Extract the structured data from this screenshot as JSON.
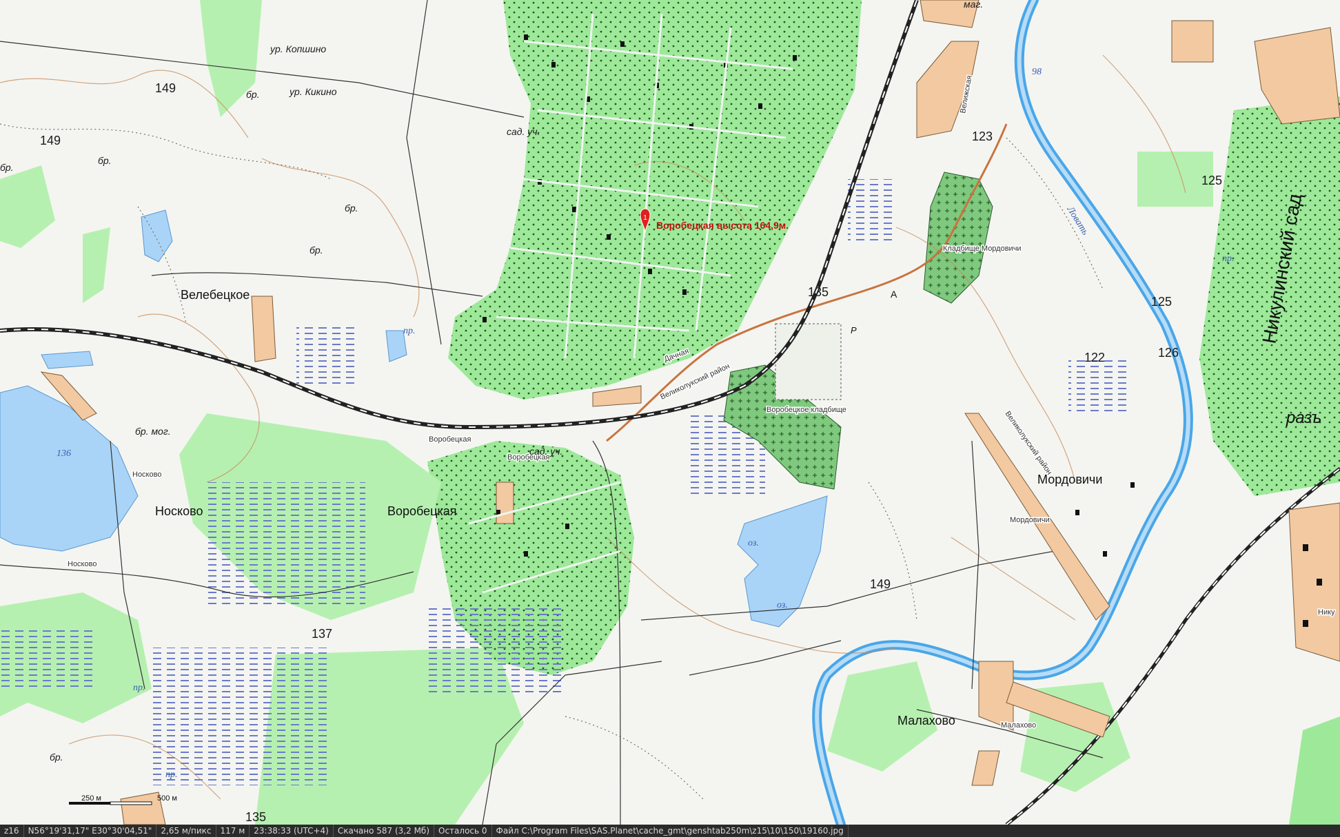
{
  "map": {
    "poi_marker": {
      "number": "1",
      "label": "Воробецкая высота 164,9м."
    },
    "settlements": [
      "Велебецкое",
      "Носково",
      "Воробецкая",
      "Мордовичи",
      "Малахово"
    ],
    "small_settlement_labels": [
      "Носково",
      "Носково",
      "Воробецкая",
      "Воробецкая",
      "Мордовичи",
      "Малахово"
    ],
    "tracts": [
      "ур. Копшино",
      "ур. Кикино"
    ],
    "garden_labels": [
      "сад. уч.",
      "сад. уч."
    ],
    "ford_labels": [
      "бр.",
      "бр.",
      "бр.",
      "бр.",
      "бр.",
      "бр."
    ],
    "ford_mog_label": "бр. мог.",
    "pond_labels": [
      "пр.",
      "пр.",
      "пр.",
      "пр."
    ],
    "lake_labels": [
      "оз.",
      "оз."
    ],
    "elevations": [
      "149",
      "149",
      "137",
      "135",
      "135",
      "123",
      "125",
      "125",
      "126",
      "122",
      "149",
      "136"
    ],
    "road_labels": [
      "A",
      "P"
    ],
    "river": {
      "name": "Ловать",
      "km_label": "98"
    },
    "cemeteries": [
      "Кладбище Мордовичи",
      "Воробецкое кладбище"
    ],
    "streets": [
      "Великолукский район",
      "Великолукский район",
      "Велижская",
      "Дачная"
    ],
    "top_label": "маг.",
    "right_labels": {
      "garden": "Никулинский сад",
      "partial": "разъ",
      "edge_town": "Нику"
    },
    "scale": {
      "left": "250 м",
      "right": "500 м"
    }
  },
  "status_bar": {
    "zoom": "z16",
    "coords": "N56°19'31,17\" E30°30'04,51\"",
    "resolution": "2,65 м/пикс",
    "distance": "117 м",
    "time": "23:38:33 (UTC+4)",
    "downloaded": "Скачано 587 (3,2 Мб)",
    "remaining": "Осталось 0",
    "file": "Файл C:\\Program Files\\SAS.Planet\\cache_gmt\\genshtab250m\\z15\\10\\150\\19160.jpg"
  },
  "colors": {
    "forest": "#9ee89a",
    "forest_dark": "#74cf73",
    "water": "#a9d4f7",
    "river": "#4aa6e8",
    "urban": "#f2c9a0",
    "paper": "#f4f5f1",
    "railway": "#222222",
    "road": "#c9733e"
  }
}
